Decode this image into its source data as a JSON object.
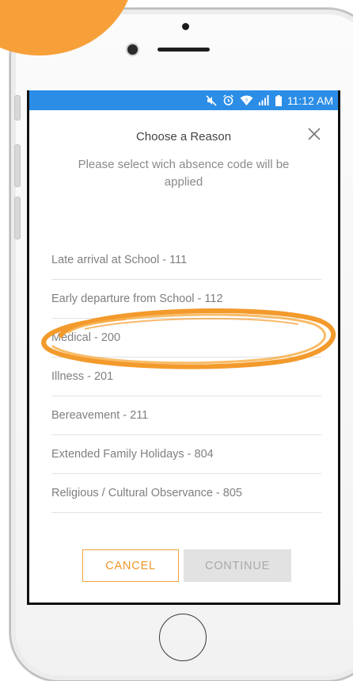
{
  "status_bar": {
    "time": "11:12 AM",
    "icons": [
      "mute-icon",
      "alarm-icon",
      "wifi-icon",
      "signal-icon",
      "battery-icon"
    ]
  },
  "dialog": {
    "title": "Choose a Reason",
    "subtitle": "Please select wich absence code will be applied",
    "close_icon": "close-icon"
  },
  "reasons": [
    {
      "label": "Late arrival at School - 111"
    },
    {
      "label": "Early departure from School - 112"
    },
    {
      "label": "Medical - 200"
    },
    {
      "label": "Illness - 201"
    },
    {
      "label": "Bereavement - 211"
    },
    {
      "label": "Extended Family Holidays - 804"
    },
    {
      "label": "Religious / Cultural Observance - 805"
    }
  ],
  "buttons": {
    "cancel": "CANCEL",
    "continue": "CONTINUE"
  },
  "colors": {
    "status_bar": "#2b8de6",
    "accent": "#f0962a",
    "disabled_bg": "#e2e2e2",
    "annotation": "#f39a2c"
  }
}
